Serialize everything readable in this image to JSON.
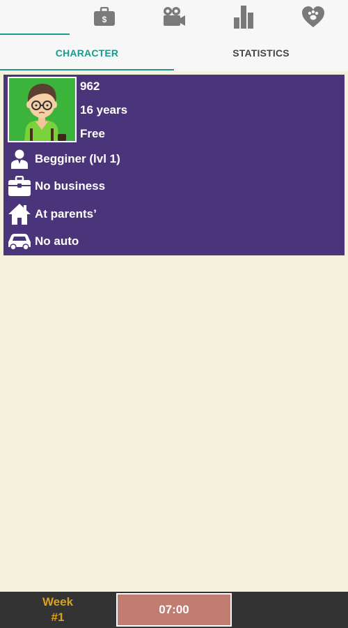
{
  "topbar": {
    "icons": [
      "briefcase-money-icon",
      "video-camera-icon",
      "bar-chart-icon",
      "heart-paw-icon"
    ],
    "active_index": 0
  },
  "tabs": [
    {
      "label": "CHARACTER",
      "active": true
    },
    {
      "label": "STATISTICS",
      "active": false
    }
  ],
  "character": {
    "money": "962",
    "age": "16 years",
    "relationship": "Free",
    "job": "Begginer (lvl 1)",
    "business": "No business",
    "home": "At parents’",
    "car": "No auto"
  },
  "bottom": {
    "week_label": "Week",
    "week_number": "#1",
    "time": "07:00"
  },
  "colors": {
    "accent": "#1a9a8e",
    "card": "#4b357a",
    "background": "#f3f0dc",
    "time_button": "#c17c71",
    "week_text": "#d9a11e",
    "bottom_bar": "#333333"
  }
}
